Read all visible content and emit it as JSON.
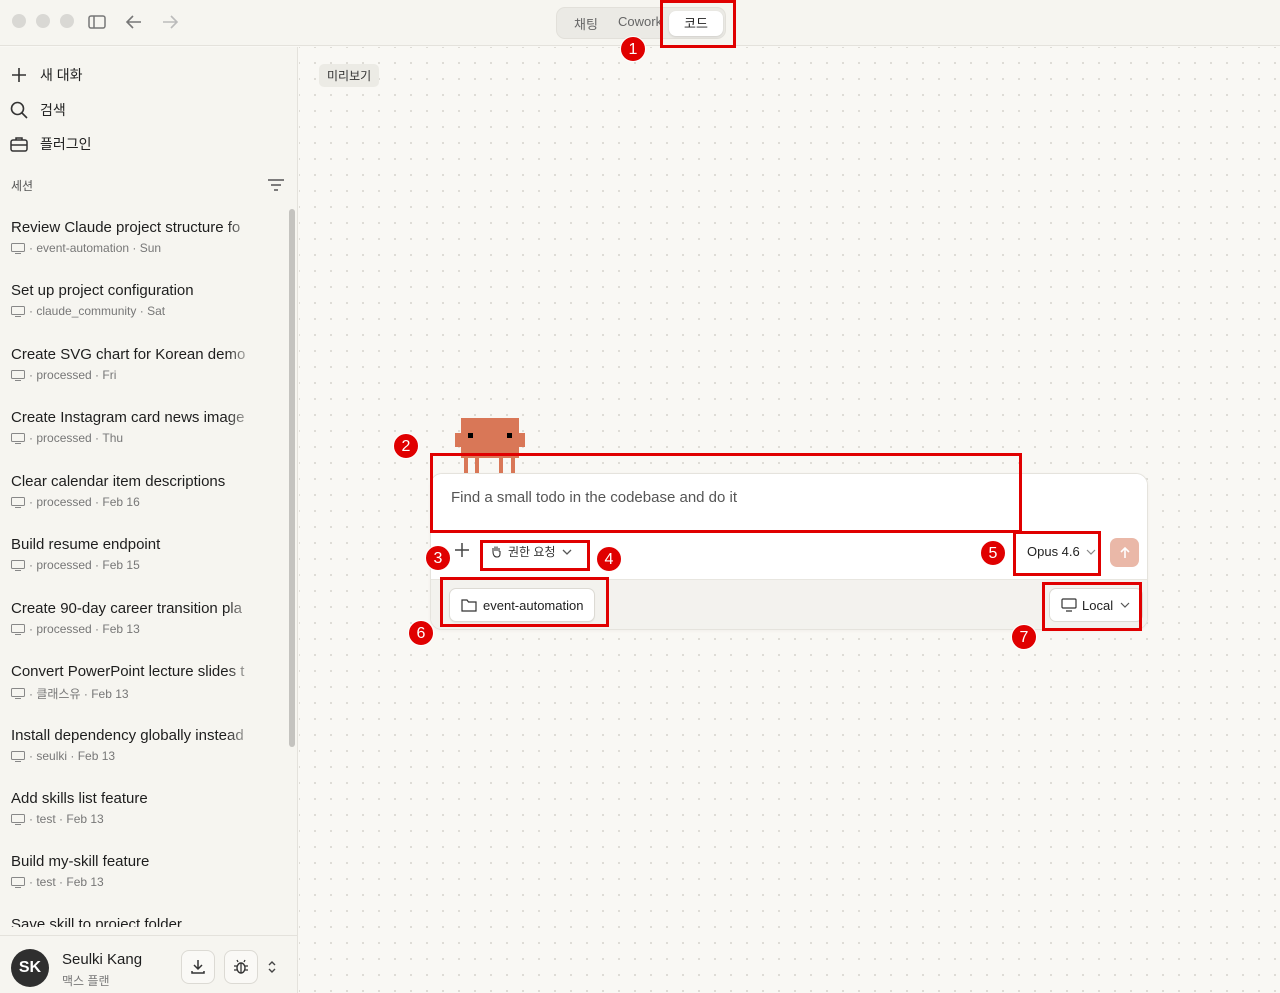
{
  "titlebar": {
    "tabs": [
      "채팅",
      "Cowork",
      "코드"
    ],
    "active_tab": "코드"
  },
  "sidebar": {
    "nav": [
      {
        "label": "새 대화",
        "icon": "plus-icon"
      },
      {
        "label": "검색",
        "icon": "search-icon"
      },
      {
        "label": "플러그인",
        "icon": "briefcase-icon"
      }
    ],
    "section_label": "세션",
    "sessions": [
      {
        "title": "Review Claude project structure fo",
        "project": "event-automation",
        "date": "Sun"
      },
      {
        "title": "Set up project configuration",
        "project": "claude_community",
        "date": "Sat"
      },
      {
        "title": "Create SVG chart for Korean demo",
        "project": "processed",
        "date": "Fri"
      },
      {
        "title": "Create Instagram card news image",
        "project": "processed",
        "date": "Thu"
      },
      {
        "title": "Clear calendar item descriptions",
        "project": "processed",
        "date": "Feb 16"
      },
      {
        "title": "Build resume endpoint",
        "project": "processed",
        "date": "Feb 15"
      },
      {
        "title": "Create 90-day career transition pla",
        "project": "processed",
        "date": "Feb 13"
      },
      {
        "title": "Convert PowerPoint lecture slides t",
        "project": "클래스유",
        "date": "Feb 13"
      },
      {
        "title": "Install dependency globally instead",
        "project": "seulki",
        "date": "Feb 13"
      },
      {
        "title": "Add skills list feature",
        "project": "test",
        "date": "Feb 13"
      },
      {
        "title": "Build my-skill feature",
        "project": "test",
        "date": "Feb 13"
      },
      {
        "title": "Save skill to project folder",
        "project": "",
        "date": ""
      }
    ],
    "user": {
      "initials": "SK",
      "name": "Seulki Kang",
      "plan": "맥스 플랜"
    }
  },
  "main": {
    "preview_label": "미리보기",
    "composer": {
      "prompt": "Find a small todo in the codebase and do it",
      "permission_label": "권한 요청",
      "model_label": "Opus 4.6",
      "folder_label": "event-automation",
      "env_label": "Local"
    }
  },
  "annotations": [
    "1",
    "2",
    "3",
    "4",
    "5",
    "6",
    "7"
  ],
  "colors": {
    "annotation": "#e00000",
    "mascot": "#d97757",
    "send_button": "#eab8a8"
  }
}
